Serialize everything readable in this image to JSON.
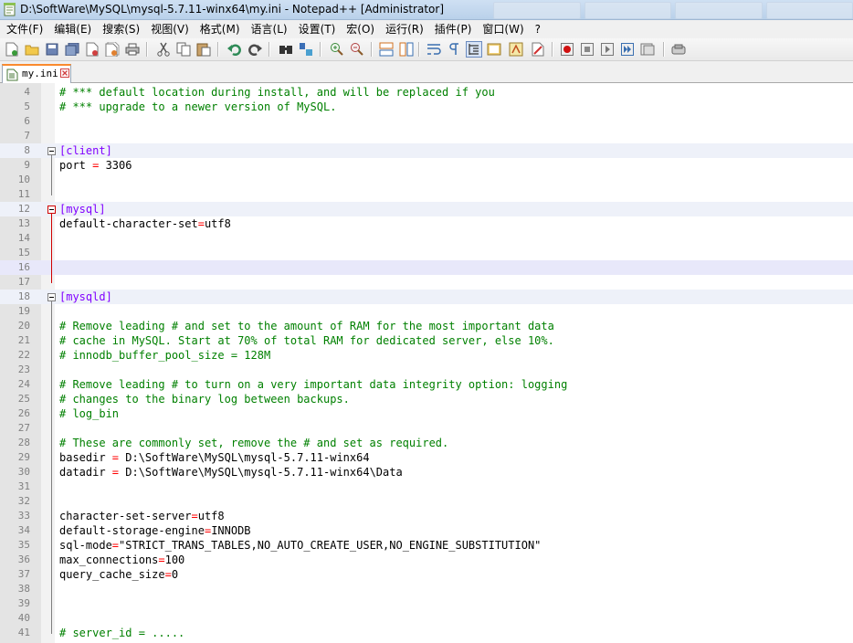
{
  "window": {
    "title": "D:\\SoftWare\\MySQL\\mysql-5.7.11-winx64\\my.ini - Notepad++ [Administrator]"
  },
  "menu": [
    "文件(F)",
    "编辑(E)",
    "搜索(S)",
    "视图(V)",
    "格式(M)",
    "语言(L)",
    "设置(T)",
    "宏(O)",
    "运行(R)",
    "插件(P)",
    "窗口(W)",
    "?"
  ],
  "toolbar": {
    "buttons": [
      "new-file-icon",
      "open-file-icon",
      "save-icon",
      "save-all-icon",
      "close-icon",
      "close-all-icon",
      "print-icon",
      "cut-icon",
      "copy-icon",
      "paste-icon",
      "undo-icon",
      "redo-icon",
      "find-icon",
      "replace-icon",
      "zoom-in-icon",
      "zoom-out-icon",
      "sync-vertical-icon",
      "sync-horizontal-icon",
      "word-wrap-icon",
      "show-all-chars-icon",
      "indent-guide-icon",
      "doc-map-icon",
      "function-list-icon",
      "folder-workspace-icon",
      "record-macro-icon",
      "stop-macro-icon",
      "play-macro-icon",
      "run-macro-multiple-icon",
      "save-macro-icon",
      "spellcheck-icon"
    ]
  },
  "tab": {
    "label": "my.ini"
  },
  "colors": {
    "comment": "#008000",
    "section": "#8000ff",
    "operator": "#ff0000",
    "gutter": "#e4e4e4"
  },
  "lines": [
    {
      "n": "4",
      "t": "comment",
      "text": "# *** default location during install, and will be replaced if you"
    },
    {
      "n": "5",
      "t": "comment",
      "text": "# *** upgrade to a newer version of MySQL."
    },
    {
      "n": "6",
      "t": "blank",
      "text": ""
    },
    {
      "n": "7",
      "t": "blank",
      "text": ""
    },
    {
      "n": "8",
      "t": "section",
      "text": "[client]"
    },
    {
      "n": "9",
      "t": "kv",
      "k": "port ",
      "v": " 3306"
    },
    {
      "n": "10",
      "t": "blank",
      "text": ""
    },
    {
      "n": "11",
      "t": "blank",
      "text": ""
    },
    {
      "n": "12",
      "t": "section",
      "text": "[mysql]"
    },
    {
      "n": "13",
      "t": "kv",
      "k": "default-character-set",
      "v": "utf8"
    },
    {
      "n": "14",
      "t": "blank",
      "text": ""
    },
    {
      "n": "15",
      "t": "blank",
      "text": ""
    },
    {
      "n": "16",
      "t": "blank",
      "text": ""
    },
    {
      "n": "17",
      "t": "blank",
      "text": ""
    },
    {
      "n": "18",
      "t": "section",
      "text": "[mysqld]"
    },
    {
      "n": "19",
      "t": "blank",
      "text": ""
    },
    {
      "n": "20",
      "t": "comment",
      "text": "# Remove leading # and set to the amount of RAM for the most important data"
    },
    {
      "n": "21",
      "t": "comment",
      "text": "# cache in MySQL. Start at 70% of total RAM for dedicated server, else 10%."
    },
    {
      "n": "22",
      "t": "comment",
      "text": "# innodb_buffer_pool_size = 128M"
    },
    {
      "n": "23",
      "t": "blank",
      "text": ""
    },
    {
      "n": "24",
      "t": "comment",
      "text": "# Remove leading # to turn on a very important data integrity option: logging"
    },
    {
      "n": "25",
      "t": "comment",
      "text": "# changes to the binary log between backups."
    },
    {
      "n": "26",
      "t": "comment",
      "text": "# log_bin"
    },
    {
      "n": "27",
      "t": "blank",
      "text": ""
    },
    {
      "n": "28",
      "t": "comment",
      "text": "# These are commonly set, remove the # and set as required."
    },
    {
      "n": "29",
      "t": "kv",
      "k": "basedir ",
      "v": " D:\\SoftWare\\MySQL\\mysql-5.7.11-winx64"
    },
    {
      "n": "30",
      "t": "kv",
      "k": "datadir ",
      "v": " D:\\SoftWare\\MySQL\\mysql-5.7.11-winx64\\Data"
    },
    {
      "n": "31",
      "t": "blank",
      "text": ""
    },
    {
      "n": "32",
      "t": "blank",
      "text": ""
    },
    {
      "n": "33",
      "t": "kv",
      "k": "character-set-server",
      "v": "utf8"
    },
    {
      "n": "34",
      "t": "kv",
      "k": "default-storage-engine",
      "v": "INNODB"
    },
    {
      "n": "35",
      "t": "kv",
      "k": "sql-mode",
      "v": "\"STRICT_TRANS_TABLES,NO_AUTO_CREATE_USER,NO_ENGINE_SUBSTITUTION\""
    },
    {
      "n": "36",
      "t": "kv",
      "k": "max_connections",
      "v": "100"
    },
    {
      "n": "37",
      "t": "kv",
      "k": "query_cache_size",
      "v": "0"
    },
    {
      "n": "38",
      "t": "blank",
      "text": ""
    },
    {
      "n": "39",
      "t": "blank",
      "text": ""
    },
    {
      "n": "40",
      "t": "blank",
      "text": ""
    },
    {
      "n": "41",
      "t": "comment",
      "text": "# server_id = ....."
    }
  ]
}
